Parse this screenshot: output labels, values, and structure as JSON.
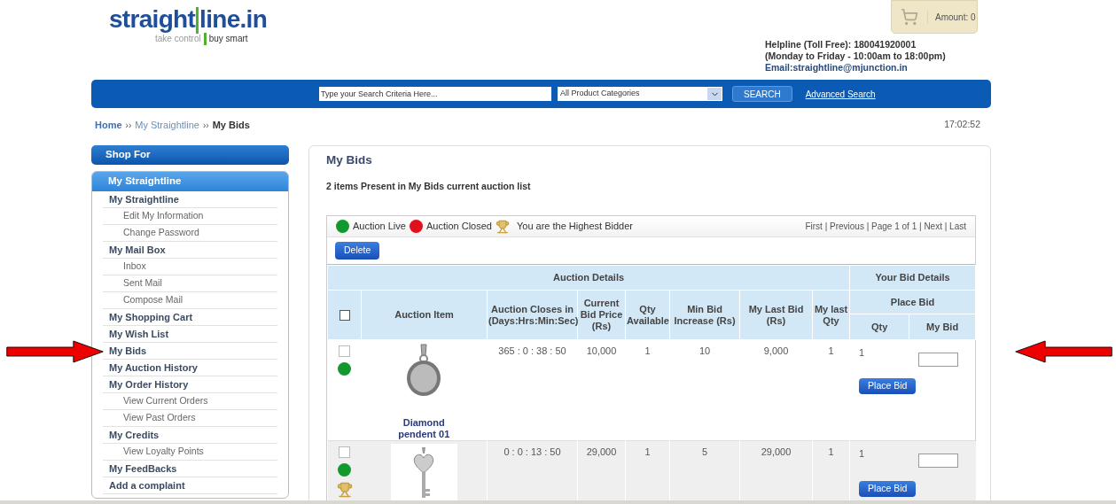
{
  "header": {
    "logo": {
      "main_dark": "straight",
      "main_green": "line.in",
      "tagline_left": "take control",
      "tagline_right": "buy smart"
    },
    "cart": {
      "amount": "Amount: 0"
    },
    "helpline": [
      "Helpline (Toll Free): 180041920001",
      "(Monday to Friday - 10:00am to 18:00pm)"
    ],
    "email": "Email:straightline@mjunction.in"
  },
  "search_bar": {
    "placeholder": "Type your Search Criteria Here...",
    "category": "All Product Categories",
    "button": "SEARCH",
    "advanced_link": "Advanced Search"
  },
  "breadcrumb": {
    "items": [
      "Home",
      "My Straightline"
    ],
    "current": "My Bids",
    "separator": "››"
  },
  "clock": "17:02:52",
  "sidebar": {
    "shop_for": "Shop For",
    "section": "My Straightline",
    "items": [
      {
        "label": "My Straightline",
        "children": [
          {
            "label": "Edit My Information"
          },
          {
            "label": "Change Password"
          }
        ]
      },
      {
        "label": "My Mail Box",
        "children": [
          {
            "label": "Inbox"
          },
          {
            "label": "Sent Mail"
          },
          {
            "label": "Compose Mail"
          }
        ]
      },
      {
        "label": "My Shopping Cart"
      },
      {
        "label": "My Wish List"
      },
      {
        "label": "My Bids"
      },
      {
        "label": "My Auction History"
      },
      {
        "label": "My Order History",
        "children": [
          {
            "label": "View Current Orders"
          },
          {
            "label": "View Past Orders"
          }
        ]
      },
      {
        "label": "My Credits",
        "children": [
          {
            "label": "View Loyalty Points"
          }
        ]
      },
      {
        "label": "My FeedBacks"
      },
      {
        "label": "Add a complaint"
      }
    ]
  },
  "main": {
    "title": "My Bids",
    "summary": "2 items Present in My Bids current auction list",
    "legend": {
      "live": "Auction Live",
      "closed": "Auction Closed",
      "highest": "You are the Highest Bidder"
    },
    "pagination": "First | Previous | Page 1 of 1 | Next | Last",
    "delete_button": "Delete",
    "table": {
      "group_left": "Auction Details",
      "group_right": "Your Bid Details",
      "place_bid_group": "Place Bid",
      "select_all_checked": false,
      "columns": [
        "Auction Item",
        "Auction Closes in (Days:Hrs:Min:Sec)",
        "Current Bid Price (Rs)",
        "Qty Available",
        "Min Bid Increase (Rs)",
        "My Last Bid (Rs)",
        "My last Qty"
      ],
      "sub_columns": [
        "Qty",
        "My Bid"
      ],
      "rows": [
        {
          "checked": false,
          "color": "#11992e",
          "highest_bidder": false,
          "item": "Diamond pendent 01",
          "closes_in": "365 : 0 : 38 : 50",
          "price": "10,000",
          "qty_available": "1",
          "min_increase": "10",
          "last_bid": "9,000",
          "last_qty": "1",
          "qty": "1",
          "button": "Place Bid"
        },
        {
          "checked": false,
          "color": "#11992e",
          "highest_bidder": true,
          "closes_in": "0 : 0 : 13 : 50",
          "price": "29,000",
          "qty_available": "1",
          "min_increase": "5",
          "last_bid": "29,000",
          "last_qty": "1",
          "qty": "1",
          "button": "Place Bid"
        }
      ]
    }
  }
}
